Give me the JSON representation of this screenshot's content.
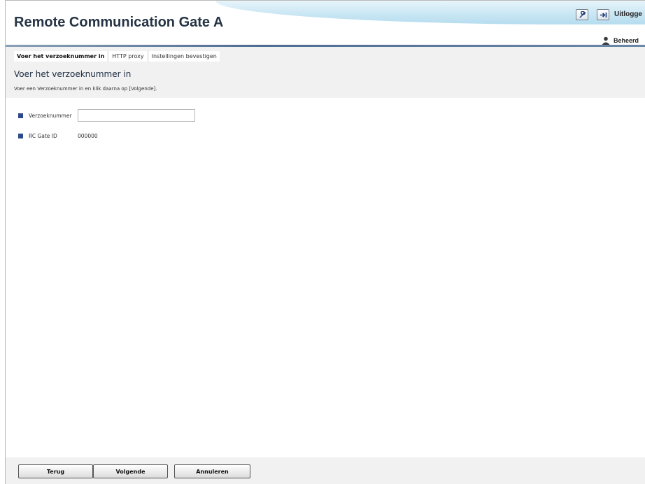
{
  "header": {
    "app_title": "Remote Communication Gate A",
    "logout_label": "Uitlogge",
    "user_label": "Beheerd",
    "tools_icon": "wrench-icon",
    "logout_icon": "logout-arrow-icon",
    "user_icon": "person-icon"
  },
  "steps": [
    {
      "label": "Voer het verzoeknummer in",
      "active": true
    },
    {
      "label": "HTTP proxy",
      "active": false
    },
    {
      "label": "Instellingen bevestigen",
      "active": false
    }
  ],
  "page": {
    "title": "Voer het verzoeknummer in",
    "instruction": "Voer een Verzoeknummer in en klik daarna op [Volgende]."
  },
  "form": {
    "request_number_label": "Verzoeknummer",
    "request_number_value": "",
    "gate_id_label": "RC Gate ID",
    "gate_id_value": "000000"
  },
  "footer": {
    "back_label": "Terug",
    "next_label": "Volgende",
    "cancel_label": "Annuleren"
  },
  "colors": {
    "bullet": "#2e4a8f",
    "header_line": "#4d6d93",
    "band": "#f1f1f1"
  }
}
